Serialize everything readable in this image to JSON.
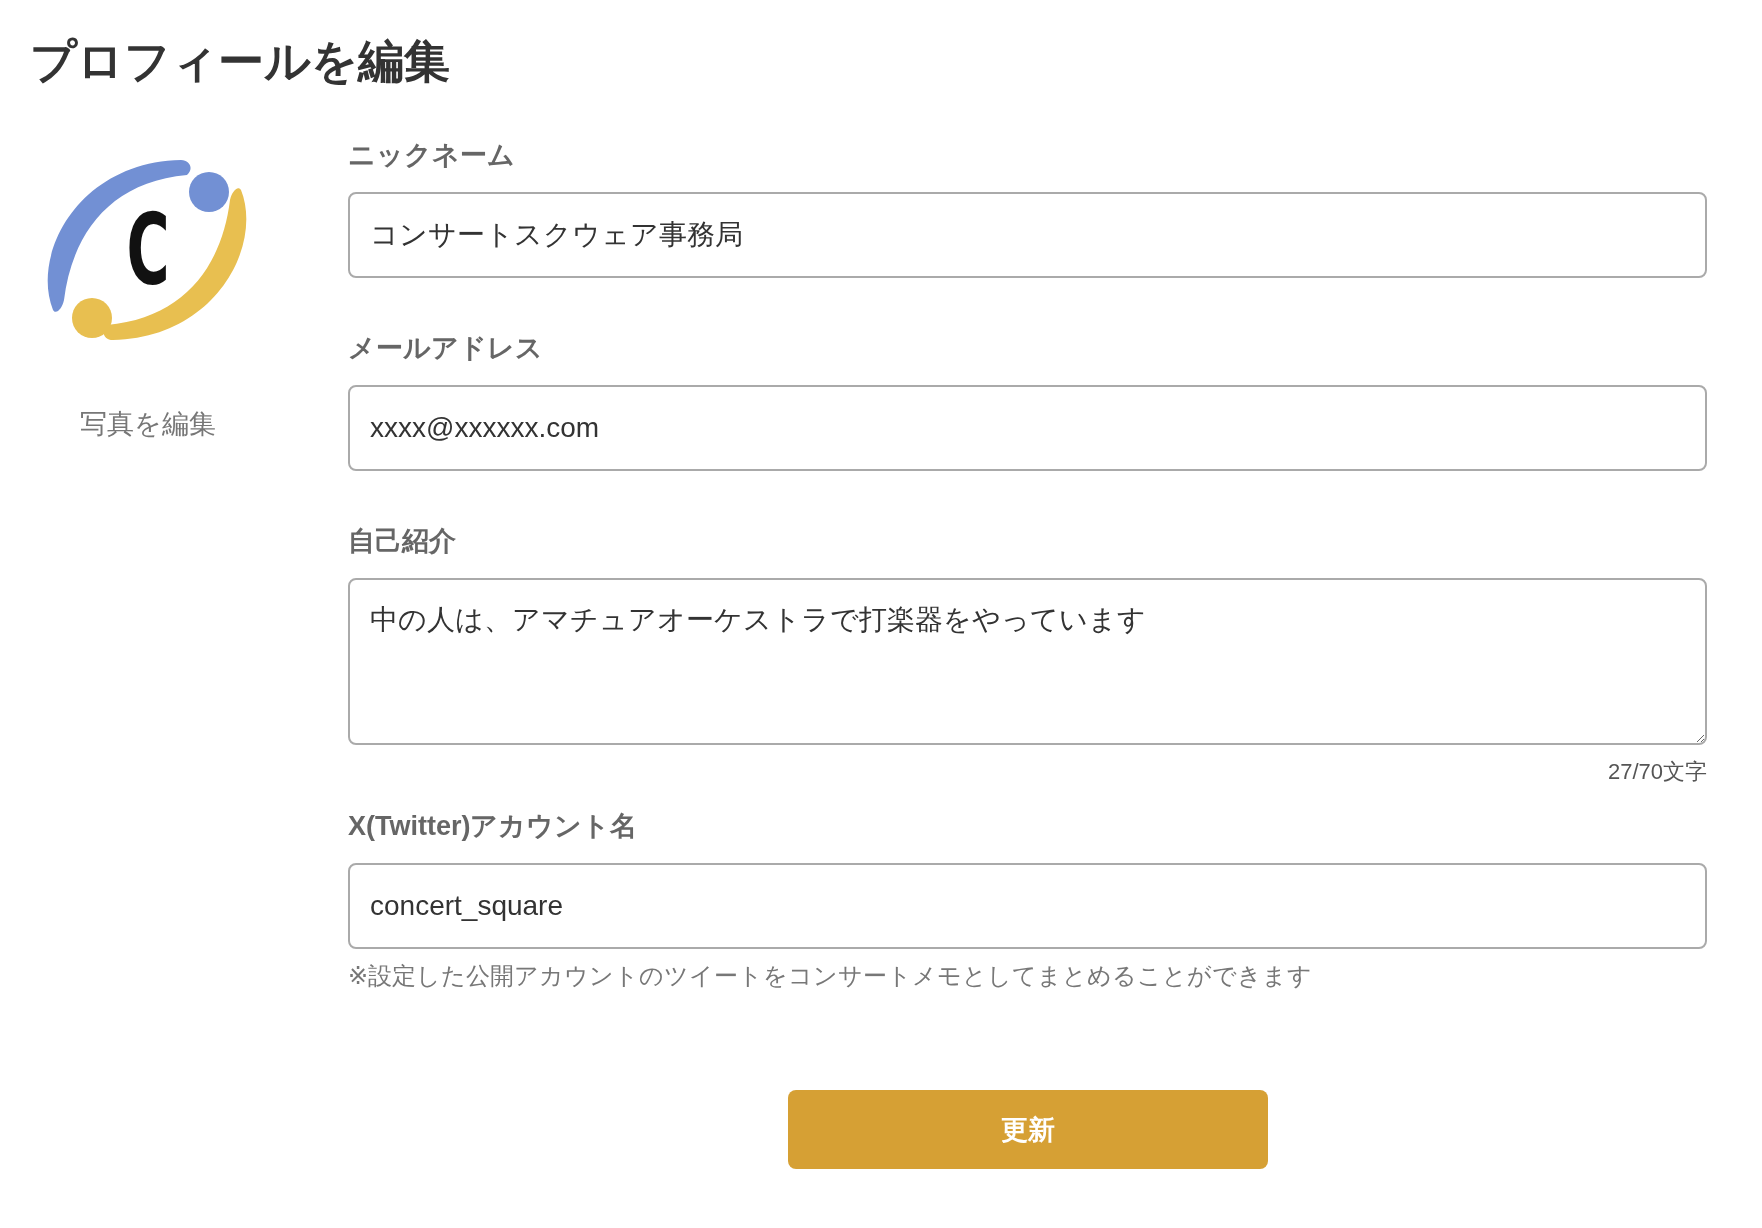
{
  "page": {
    "title": "プロフィールを編集"
  },
  "photo": {
    "logo_letter": "C",
    "edit_label": "写真を編集"
  },
  "fields": [
    {
      "kind": "text",
      "label": "ニックネーム",
      "value": "コンサートスクウェア事務局"
    },
    {
      "kind": "text",
      "label": "メールアドレス",
      "value": "xxxx@xxxxxx.com"
    },
    {
      "kind": "textarea",
      "label": "自己紹介",
      "value": "中の人は、アマチュアオーケストラで打楽器をやっています",
      "counter": "27/70文字"
    },
    {
      "kind": "text",
      "label": "X(Twitter)アカウント名",
      "value": "concert_square",
      "note": "※設定した公開アカウントのツイートをコンサートメモとしてまとめることができます"
    }
  ],
  "submit": {
    "label": "更新"
  }
}
